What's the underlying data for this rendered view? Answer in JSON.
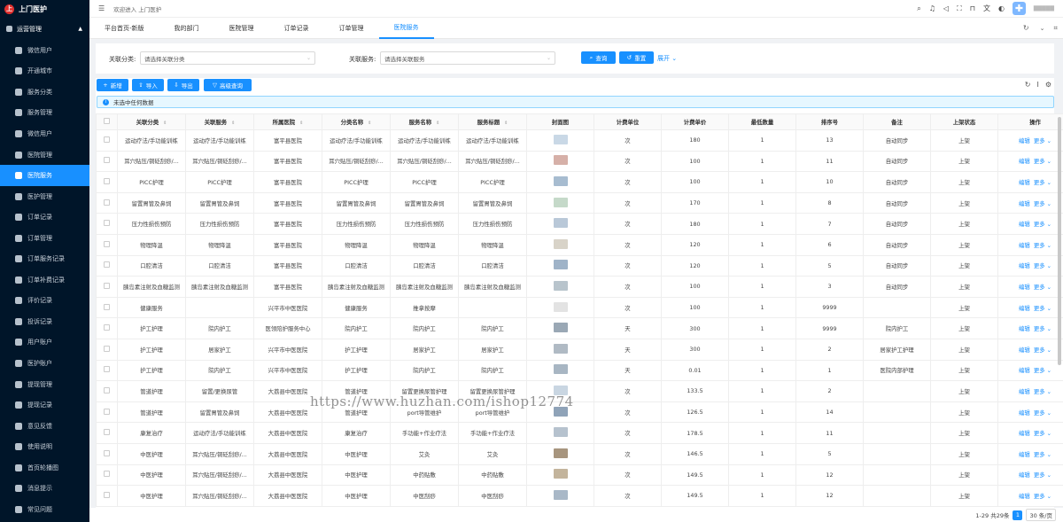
{
  "app": {
    "name": "上门医护",
    "logo_letter": "上"
  },
  "sidebar": {
    "group": "运营管理",
    "items": [
      {
        "label": "微信用户",
        "icon": "user-icon"
      },
      {
        "label": "开通城市",
        "icon": "city-icon"
      },
      {
        "label": "服务分类",
        "icon": "category-icon"
      },
      {
        "label": "服务管理",
        "icon": "cart-icon"
      },
      {
        "label": "微信用户",
        "icon": "user-icon"
      },
      {
        "label": "医院管理",
        "icon": "hospital-icon"
      },
      {
        "label": "医院服务",
        "icon": "service-icon",
        "active": true
      },
      {
        "label": "医护管理",
        "icon": "nurse-icon"
      },
      {
        "label": "订单记录",
        "icon": "order-icon"
      },
      {
        "label": "订单管理",
        "icon": "order-manage-icon"
      },
      {
        "label": "订单服务记录",
        "icon": "record-icon"
      },
      {
        "label": "订单补费记录",
        "icon": "fee-icon"
      },
      {
        "label": "评价记录",
        "icon": "review-icon"
      },
      {
        "label": "投诉记录",
        "icon": "complaint-icon"
      },
      {
        "label": "用户账户",
        "icon": "account-icon"
      },
      {
        "label": "医护账户",
        "icon": "nurse-account-icon"
      },
      {
        "label": "提现管理",
        "icon": "withdraw-icon"
      },
      {
        "label": "提现记录",
        "icon": "withdraw-record-icon"
      },
      {
        "label": "意见反馈",
        "icon": "feedback-icon"
      },
      {
        "label": "使用说明",
        "icon": "manual-icon"
      },
      {
        "label": "首页轮播图",
        "icon": "image-icon"
      },
      {
        "label": "消息提示",
        "icon": "message-icon"
      },
      {
        "label": "常见问题",
        "icon": "faq-icon"
      }
    ]
  },
  "topbar": {
    "welcome": "欢迎进入 上门医护",
    "menu_icon": "☰",
    "user": "▇▇▇▇▇"
  },
  "tabs": [
    "平台首页-新版",
    "我的部门",
    "医院管理",
    "订单记录",
    "订单管理",
    "医院服务"
  ],
  "filters": {
    "f1_label": "关联分类:",
    "f1_placeholder": "请选择关联分类",
    "f2_label": "关联服务:",
    "f2_placeholder": "请选择关联服务",
    "search": "查询",
    "reset": "重置",
    "expand": "展开"
  },
  "toolbar": {
    "add": "新增",
    "import": "导入",
    "export": "导出",
    "advanced": "高级查询"
  },
  "alert": "未选中任何数据",
  "table": {
    "headers": [
      "关联分类",
      "关联服务",
      "所属医院",
      "分类名称",
      "服务名称",
      "服务标题",
      "封面图",
      "计费单位",
      "计费单价",
      "最低数量",
      "排序号",
      "备注",
      "上架状态",
      "操作"
    ],
    "action_edit": "编辑",
    "action_more": "更多",
    "rows": [
      [
        "运动疗法/手功能训练",
        "运动疗法/手功能训练",
        "富平县医院",
        "运动疗法/手功能训练",
        "运动疗法/手功能训练",
        "运动疗法/手功能训练",
        "次",
        "180",
        "1",
        "13",
        "自动同步",
        "上架"
      ],
      [
        "耳穴贴压/铜砭刮痧/...",
        "耳穴贴压/铜砭刮痧/...",
        "富平县医院",
        "耳穴贴压/铜砭刮痧/...",
        "耳穴贴压/铜砭刮痧/...",
        "耳穴贴压/铜砭刮痧/...",
        "次",
        "100",
        "1",
        "11",
        "自动同步",
        "上架"
      ],
      [
        "PICC护理",
        "PICC护理",
        "富平县医院",
        "PICC护理",
        "PICC护理",
        "PICC护理",
        "次",
        "100",
        "1",
        "10",
        "自动同步",
        "上架"
      ],
      [
        "留置胃管及鼻饲",
        "留置胃管及鼻饲",
        "富平县医院",
        "留置胃管及鼻饲",
        "留置胃管及鼻饲",
        "留置胃管及鼻饲",
        "次",
        "170",
        "1",
        "8",
        "自动同步",
        "上架"
      ],
      [
        "压力性损伤预防",
        "压力性损伤预防",
        "富平县医院",
        "压力性损伤预防",
        "压力性损伤预防",
        "压力性损伤预防",
        "次",
        "180",
        "1",
        "7",
        "自动同步",
        "上架"
      ],
      [
        "物理降温",
        "物理降温",
        "富平县医院",
        "物理降温",
        "物理降温",
        "物理降温",
        "次",
        "120",
        "1",
        "6",
        "自动同步",
        "上架"
      ],
      [
        "口腔清洁",
        "口腔清洁",
        "富平县医院",
        "口腔清洁",
        "口腔清洁",
        "口腔清洁",
        "次",
        "120",
        "1",
        "5",
        "自动同步",
        "上架"
      ],
      [
        "胰岛素注射及血糖监测",
        "胰岛素注射及血糖监测",
        "富平县医院",
        "胰岛素注射及血糖监测",
        "胰岛素注射及血糖监测",
        "胰岛素注射及血糖监测",
        "次",
        "100",
        "1",
        "3",
        "自动同步",
        "上架"
      ],
      [
        "健康服务",
        "",
        "兴平市中医医院",
        "健康服务",
        "推拿按摩",
        "",
        "次",
        "100",
        "1",
        "9999",
        "",
        "上架"
      ],
      [
        "护工护理",
        "院内护工",
        "医领陪护服务中心",
        "院内护工",
        "院内护工",
        "院内护工",
        "天",
        "300",
        "1",
        "9999",
        "院内护工",
        "上架"
      ],
      [
        "护工护理",
        "居家护工",
        "兴平市中医医院",
        "护工护理",
        "居家护工",
        "居家护工",
        "天",
        "300",
        "1",
        "2",
        "居家护工护理",
        "上架"
      ],
      [
        "护工护理",
        "院内护工",
        "兴平市中医医院",
        "护工护理",
        "院内护工",
        "院内护工",
        "天",
        "0.01",
        "1",
        "1",
        "医院内部护理",
        "上架"
      ],
      [
        "管道护理",
        "留置/更换尿管",
        "大荔县中医医院",
        "管道护理",
        "留置更换尿管护理",
        "留置更换尿管护理",
        "次",
        "133.5",
        "1",
        "2",
        "",
        "上架"
      ],
      [
        "管道护理",
        "留置胃管及鼻饲",
        "大荔县中医医院",
        "管道护理",
        "port导管维护",
        "port导管维护",
        "次",
        "126.5",
        "1",
        "14",
        "",
        "上架"
      ],
      [
        "康复治疗",
        "运动疗法/手功能训练",
        "大荔县中医医院",
        "康复治疗",
        "手功能+作业疗法",
        "手功能+作业疗法",
        "次",
        "178.5",
        "1",
        "11",
        "",
        "上架"
      ],
      [
        "中医护理",
        "耳穴贴压/铜砭刮痧/...",
        "大荔县中医医院",
        "中医护理",
        "艾灸",
        "艾灸",
        "次",
        "146.5",
        "1",
        "5",
        "",
        "上架"
      ],
      [
        "中医护理",
        "耳穴贴压/铜砭刮痧/...",
        "大荔县中医医院",
        "中医护理",
        "中药贴敷",
        "中药贴敷",
        "次",
        "149.5",
        "1",
        "12",
        "",
        "上架"
      ],
      [
        "中医护理",
        "耳穴贴压/铜砭刮痧/...",
        "大荔县中医医院",
        "中医护理",
        "中医刮痧",
        "中医刮痧",
        "次",
        "149.5",
        "1",
        "12",
        "",
        "上架"
      ]
    ]
  },
  "pagination": {
    "summary": "1-29 共29条",
    "current": "1",
    "size": "30 条/页"
  },
  "watermark": "https://www.huzhan.com/ishop12774",
  "colors": {
    "primary": "#1890ff",
    "sidebar_bg": "#001529"
  }
}
